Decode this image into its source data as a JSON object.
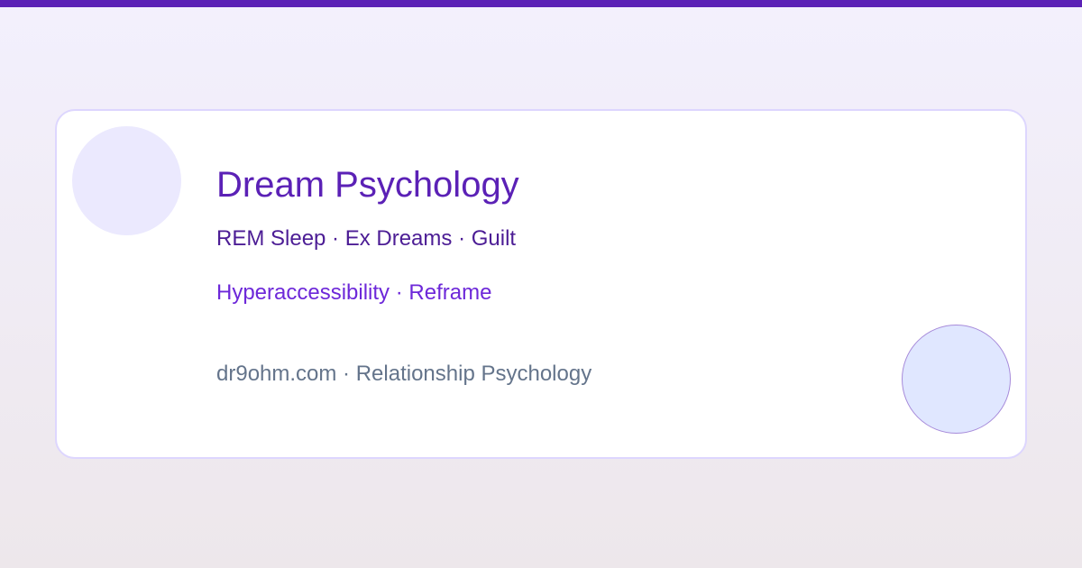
{
  "colors": {
    "accent": "#5b21b6",
    "card_background": "#ffffff",
    "card_border": "#ddd6fe",
    "primary_tags": "#4c1d95",
    "secondary_tags": "#6d28d9",
    "footer_text": "#64748b"
  },
  "card": {
    "title": "Dream Psychology",
    "primary_tags": "REM Sleep · Ex Dreams · Guilt",
    "secondary_tags": "Hyperaccessibility · Reframe",
    "footer": "dr9ohm.com · Relationship Psychology"
  }
}
